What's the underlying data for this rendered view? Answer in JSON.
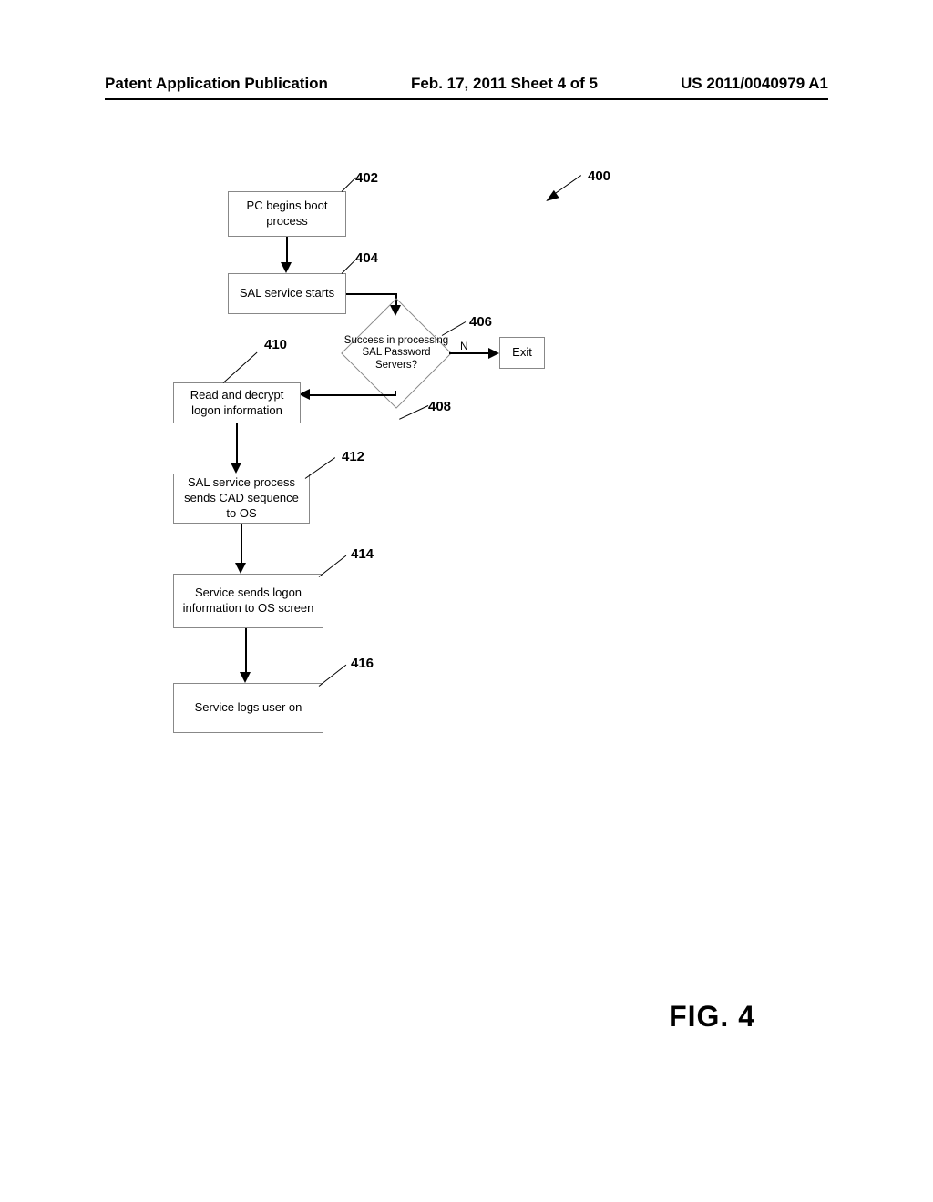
{
  "header": {
    "left": "Patent Application Publication",
    "center": "Feb. 17, 2011  Sheet 4 of 5",
    "right": "US 2011/0040979 A1"
  },
  "figure_label": "FIG. 4",
  "refs": {
    "r400": "400",
    "r402": "402",
    "r404": "404",
    "r406": "406",
    "r408": "408",
    "r410": "410",
    "r412": "412",
    "r414": "414",
    "r416": "416"
  },
  "boxes": {
    "b402": "PC begins boot process",
    "b404": "SAL service starts",
    "b410": "Read and decrypt logon information",
    "b412": "SAL service process sends CAD sequence to OS",
    "b414": "Service sends logon information to OS screen",
    "b416": "Service logs user on",
    "exit": "Exit"
  },
  "diamond": {
    "d406": "Success in processing SAL Password Servers?"
  },
  "edges": {
    "n_label": "N"
  }
}
